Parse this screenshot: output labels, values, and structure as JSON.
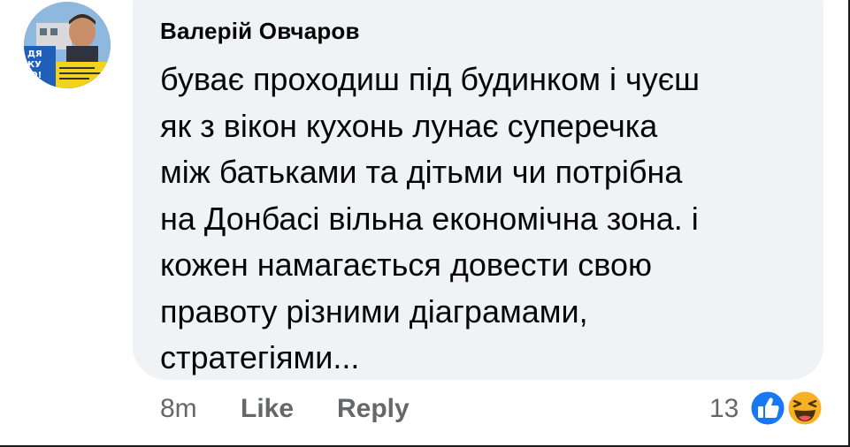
{
  "comment": {
    "author": "Валерій Овчаров",
    "text_lines": [
      "буває проходиш під будинком і чуєш",
      "як з вікон кухонь лунає суперечка",
      "між батьками та дітьми чи потрібна",
      "на Донбасі вільна економічна зона. і",
      "кожен намагається довести свою",
      "правоту різними діаграмами,",
      "стратегіями..."
    ],
    "timestamp": "8m",
    "like_label": "Like",
    "reply_label": "Reply",
    "reaction_count": "13",
    "reactions": [
      "like-icon",
      "haha-icon"
    ]
  },
  "avatar": {
    "text_lines": [
      "ДЯ",
      "КУ",
      "Ю!"
    ]
  },
  "colors": {
    "bubble": "#f0f2f5",
    "text": "#050505",
    "secondary_text": "#65676b",
    "like_blue": "#1877f2",
    "haha_yellow": "#f7b125"
  }
}
